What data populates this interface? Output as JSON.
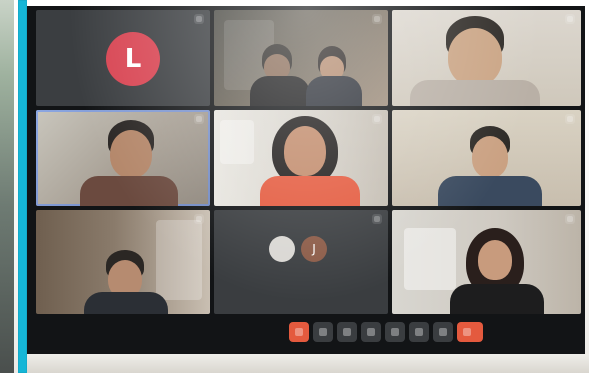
{
  "meeting": {
    "participants": [
      {
        "id": 1,
        "initial": "L",
        "name": ""
      },
      {
        "id": 2,
        "name": ""
      },
      {
        "id": 3,
        "name": ""
      },
      {
        "id": 4,
        "name": ""
      },
      {
        "id": 5,
        "name": ""
      },
      {
        "id": 6,
        "name": ""
      },
      {
        "id": 7,
        "name": ""
      },
      {
        "id": 8,
        "name": "",
        "avatar_initial": "J"
      },
      {
        "id": 9,
        "name": ""
      }
    ],
    "meeting_code": ""
  },
  "toolbar": {
    "buttons": [
      {
        "name": "record",
        "color": "#e45a3e"
      },
      {
        "name": "camera"
      },
      {
        "name": "mic"
      },
      {
        "name": "present"
      },
      {
        "name": "captions"
      },
      {
        "name": "raise-hand"
      },
      {
        "name": "more"
      },
      {
        "name": "leave-call",
        "color": "#e45a3e"
      }
    ]
  },
  "colors": {
    "accent_bezel": "#15b6d7",
    "avatar_red": "#d84452",
    "call_red": "#e45a3e"
  }
}
